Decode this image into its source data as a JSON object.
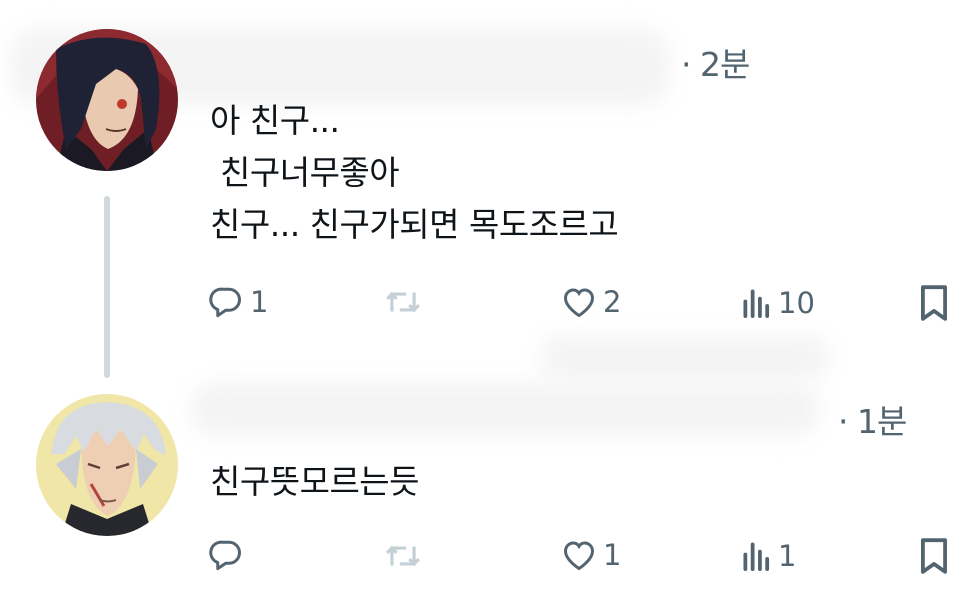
{
  "tweets": [
    {
      "time": "· 2분",
      "lines": [
        "아 친구...",
        " 친구너무좋아",
        "친구... 친구가되면 목도조르고"
      ],
      "actions": {
        "reply": "1",
        "retweet": "",
        "like": "2",
        "views": "10"
      }
    },
    {
      "time": "· 1분",
      "lines": [
        "친구뜻모르는듯"
      ],
      "actions": {
        "reply": "",
        "retweet": "",
        "like": "1",
        "views": "1"
      }
    }
  ],
  "icons": [
    "reply-icon",
    "retweet-icon",
    "like-icon",
    "views-icon",
    "bookmark-icon"
  ],
  "colors": {
    "text": "#0f1419",
    "muted": "#536471",
    "thread_line": "#cfd9de"
  }
}
